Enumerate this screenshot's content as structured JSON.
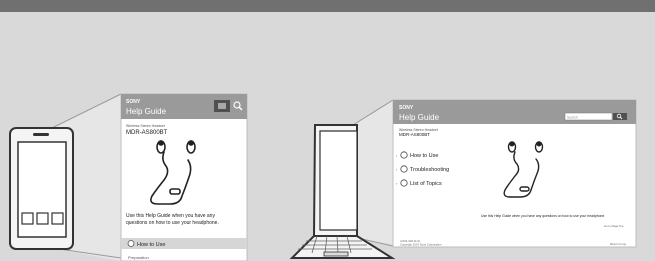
{
  "brand": "SONY",
  "phone_screen": {
    "title": "Help Guide",
    "subtitle": "Wireless Stereo Headset",
    "model": "MDR-AS800BT",
    "intro_line1": "Use this Help Guide when you have any",
    "intro_line2": "questions on how to use your headphone.",
    "menu_item_1": "How to Use",
    "menu_item_2": "Preparation"
  },
  "laptop_screen": {
    "title": "Help Guide",
    "subtitle": "Wireless Stereo Headset",
    "model": "MDR-AS800BT",
    "search_placeholder": "Search",
    "nav": [
      "How to Use",
      "Troubleshooting",
      "List of Topics"
    ],
    "intro": "Use this Help Guide when you have any questions on how to use your headphone.",
    "page_top": "Go to Page Top",
    "footer_left_1": "4-543-418-11(1)",
    "footer_left_2": "Copyright 2014 Sony Corporation",
    "footer_right": "Return to top"
  },
  "colors": {
    "background": "#d9d9d9",
    "header_bar": "#707070",
    "screen_header": "#9a9a9a",
    "outline": "#333333"
  }
}
